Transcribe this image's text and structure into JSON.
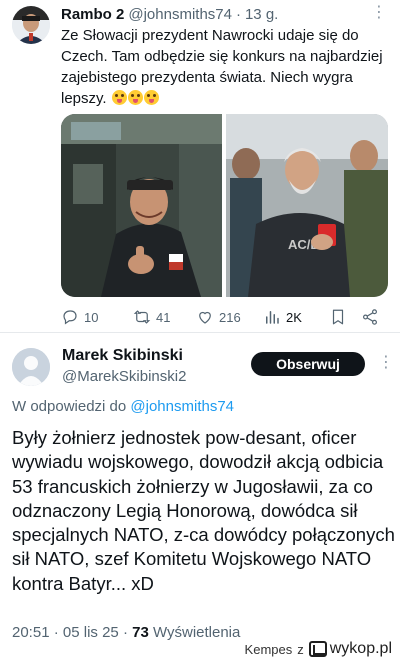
{
  "tweet": {
    "author_name": "Rambo 2",
    "author_handle": "@johnsmiths74",
    "time_sep": "·",
    "time": "13 g.",
    "more_icon": "more-dots-icon",
    "text": "Ze Słowacji prezydent Nawrocki udaje się do Czech. Tam odbędzie się konkurs na najbardziej zajebistego prezydenta świata. Niech wygra lepszy.",
    "emoji_count": 3,
    "actions": {
      "replies": "10",
      "retweets": "41",
      "likes": "216",
      "views": "2K"
    }
  },
  "reply": {
    "author_name": "Marek Skibinski",
    "author_handle": "@MarekSkibinski2",
    "follow_label": "Obserwuj",
    "reply_prefix": "W odpowiedzi do",
    "reply_to_handle": "@johnsmiths74",
    "text": "Były żołnierz jednostek pow-desant, oficer wywiadu wojskowego, dowodził akcją odbicia 53 francuskich żołnierzy w Jugosławii, za co odznaczony Legią Honorową, dowódca sił specjalnych NATO, z-ca dowódcy połączonych sił NATO, szef Komitetu Wojskowego NATO kontra Batyr... xD",
    "time": "20:51",
    "sep": "·",
    "date": "05 lis 25",
    "views_count": "73",
    "views_label": "Wyświetlenia"
  },
  "watermark": {
    "author": "Kempes",
    "prefix": "z",
    "site": "wykop.pl"
  },
  "colors": {
    "text": "#0f1419",
    "secondary": "#536471",
    "link": "#1d9bf0",
    "button_bg": "#0f1419"
  }
}
